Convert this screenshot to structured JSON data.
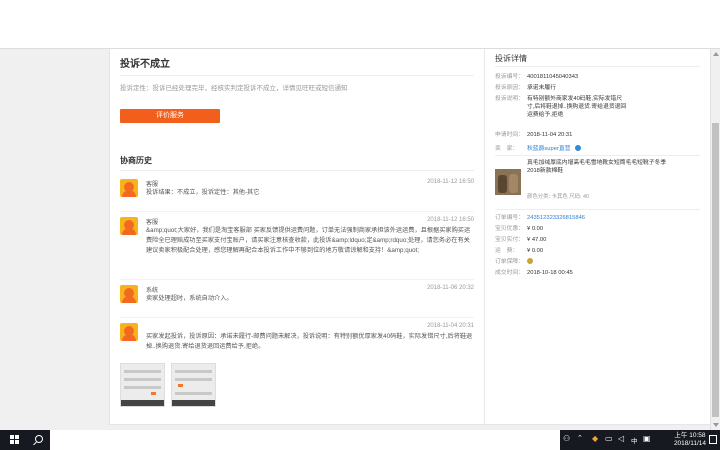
{
  "main": {
    "status_title": "投诉不成立",
    "status_line": "投诉定性：投诉已经处理完毕，经核实判定投诉不成立，详情见旺旺或短信通知",
    "rate_button": "评价服务",
    "history_title": "协商历史",
    "entries": [
      {
        "name": "客服",
        "time": "2018-11-12 16:50",
        "text": "投诉结果：不成立，投诉定性：其他-其它"
      },
      {
        "name": "客服",
        "time": "2018-11-12 16:50",
        "text": "&amp;quot;大家好，我们是淘宝客服部 买家反馈提供运费问题，订单无法强制商家承担该外运运费，且根据买家购买运费险全已理赔成功至买家支付宝账户，请买家注意核查收款，此投诉&amp;ldquo;定&amp;rdquo;处理，请您务必在有关建议卖家积极配合处理，感您理解再配合本投诉工作中不够到位的地方敬请谅解和支持！&amp;quot;"
      },
      {
        "name": "系统",
        "time": "2018-11-06 20:32",
        "text": "卖家处理超时，系统自动介入。"
      },
      {
        "name": "",
        "time": "2018-11-04 20:31",
        "text": "买家发起投诉，投诉原因：承诺未履行-邮费问题未解决，投诉说明：有特别额优厚家发40码鞋，实际发错尺寸,后将鞋退掉..换购退货.寄给退货退回运费给予,拒绝。"
      }
    ]
  },
  "sidebar": {
    "title": "投诉详情",
    "fields_top": [
      {
        "k": "投诉编号：",
        "v": "4001811045040343"
      },
      {
        "k": "投诉原因：",
        "v": "承诺未履行"
      },
      {
        "k": "投诉说明：",
        "v": "有特别额外商家发40码鞋,实际发错尺寸,后将鞋退掉..换购退货.寄给退货退回运费给予,拒绝"
      },
      {
        "k": "申请时间：",
        "v": "2018-11-04 20:31"
      },
      {
        "k": "卖　家：",
        "v": "秋蓝爵super直营"
      }
    ],
    "product": {
      "title": "真毛加绒厚底内增高毛毛雪地靴女短筒毛毛短靴子冬季2018新款棉鞋",
      "sku": "颜色分类: 卡其色 尺码: 40"
    },
    "fields_bottom": [
      {
        "k": "订单编号：",
        "v": "243512323326815846"
      },
      {
        "k": "宝贝优惠：",
        "v": "¥ 0.00"
      },
      {
        "k": "宝贝实付：",
        "v": "¥ 47.00"
      },
      {
        "k": "运　费：",
        "v": "¥ 0.00"
      },
      {
        "k": "订单保障：",
        "v": ""
      },
      {
        "k": "成交时间：",
        "v": "2018-10-18 00:45"
      }
    ]
  },
  "taskbar": {
    "time": "上午 10:58",
    "date": "2018/11/14",
    "ime": "中"
  },
  "colors": {
    "accent": "#f25f1d",
    "link": "#2b7fd8",
    "taskbar": "#16191f"
  }
}
